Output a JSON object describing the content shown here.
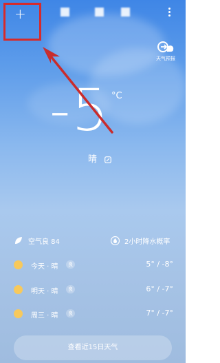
{
  "header": {
    "add_icon": "+",
    "more_icon": "more-vertical-icon"
  },
  "forecast_video": {
    "label": "天气预报"
  },
  "current": {
    "temperature": "-5",
    "unit": "°C",
    "condition": "晴"
  },
  "air_quality": {
    "text": "空气良 84"
  },
  "precip": {
    "text": "2小时降水概率"
  },
  "days": [
    {
      "label": "今天 · 晴",
      "badge": "良",
      "range": "5° / -8°"
    },
    {
      "label": "明天 · 晴",
      "badge": "良",
      "range": "6° / -7°"
    },
    {
      "label": "周三 · 晴",
      "badge": "良",
      "range": "7° / -7°"
    }
  ],
  "footer": {
    "button_label": "查看近15日天气"
  },
  "colors": {
    "highlight_box": "#d72a2a",
    "arrow": "#c92c2c",
    "sun": "#f7c95c"
  }
}
